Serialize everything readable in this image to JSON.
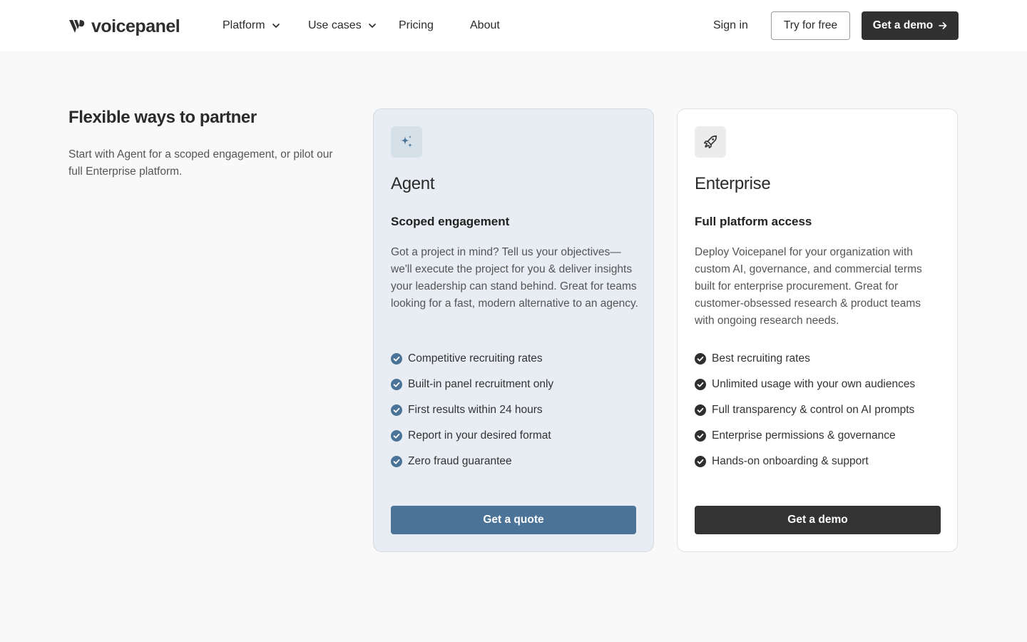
{
  "brand": {
    "name": "voicepanel"
  },
  "nav": {
    "items": [
      {
        "label": "Platform",
        "has_dropdown": true
      },
      {
        "label": "Use cases",
        "has_dropdown": true
      },
      {
        "label": "Pricing",
        "has_dropdown": false
      },
      {
        "label": "About",
        "has_dropdown": false
      }
    ],
    "sign_in": "Sign in",
    "try_free": "Try for free",
    "get_demo": "Get a demo"
  },
  "intro": {
    "title": "Flexible ways to partner",
    "text": "Start with Agent for a scoped engagement, or pilot our full Enterprise platform."
  },
  "plans": [
    {
      "id": "agent",
      "icon": "sparkles-icon",
      "title": "Agent",
      "subtitle": "Scoped engagement",
      "description": "Got a project in mind? Tell us your objectives—we'll execute the project for you & deliver insights your leadership can stand behind. Great for teams looking for a fast, modern alternative to an agency.",
      "features": [
        "Competitive recruiting rates",
        "Built-in panel recruitment only",
        "First results within 24 hours",
        "Report in your desired format",
        "Zero fraud guarantee"
      ],
      "cta": "Get a quote"
    },
    {
      "id": "enterprise",
      "icon": "rocket-icon",
      "title": "Enterprise",
      "subtitle": "Full platform access",
      "description": "Deploy Voicepanel for your organization with custom AI, governance, and commercial terms built for enterprise procurement. Great for customer-obsessed research & product teams with ongoing research needs.",
      "features": [
        "Best recruiting rates",
        "Unlimited usage with your own audiences",
        "Full transparency & control on AI prompts",
        "Enterprise permissions & governance",
        "Hands-on onboarding & support"
      ],
      "cta": "Get a demo"
    }
  ],
  "colors": {
    "agent_accent": "#4b7398",
    "enterprise_accent": "#333333",
    "agent_card_bg": "#e7edf2",
    "page_bg": "#f9f9f9"
  }
}
